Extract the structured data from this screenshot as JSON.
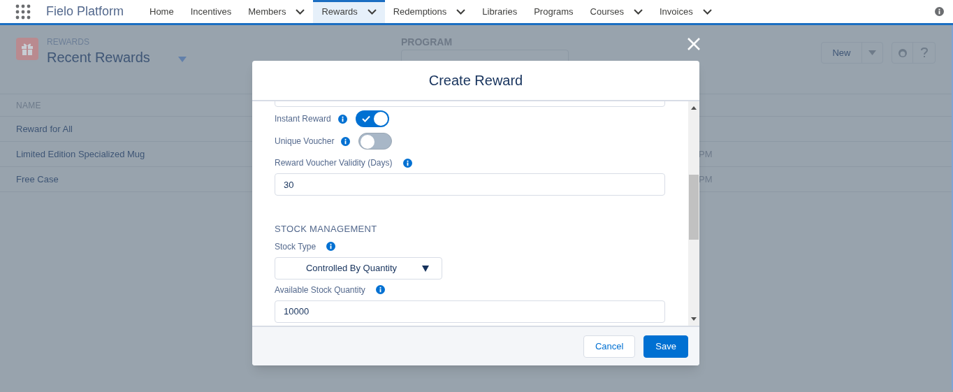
{
  "app": {
    "title": "Fielo Platform"
  },
  "nav": [
    {
      "label": "Home",
      "selected": false,
      "has_menu": false
    },
    {
      "label": "Incentives",
      "selected": false,
      "has_menu": false
    },
    {
      "label": "Members",
      "selected": false,
      "has_menu": true
    },
    {
      "label": "Rewards",
      "selected": true,
      "has_menu": true
    },
    {
      "label": "Redemptions",
      "selected": false,
      "has_menu": true
    },
    {
      "label": "Libraries",
      "selected": false,
      "has_menu": false
    },
    {
      "label": "Programs",
      "selected": false,
      "has_menu": false
    },
    {
      "label": "Courses",
      "selected": false,
      "has_menu": true
    },
    {
      "label": "Invoices",
      "selected": false,
      "has_menu": true
    }
  ],
  "page": {
    "object": "REWARDS",
    "list_view": "Recent Rewards",
    "program_label": "PROGRAM",
    "new_button": "New"
  },
  "table": {
    "columns": [
      "NAME"
    ],
    "rows": [
      {
        "name": "Reward for All",
        "column_2": ""
      },
      {
        "name": "Limited Edition Specialized Mug",
        "column_2": "PM"
      },
      {
        "name": "Free Case",
        "column_2": "PM"
      }
    ]
  },
  "modal": {
    "title": "Create Reward",
    "fields": [
      {
        "kind": "toggle",
        "label": "Instant Reward",
        "checked": true
      },
      {
        "kind": "toggle",
        "label": "Unique Voucher",
        "checked": false
      },
      {
        "kind": "input",
        "label": "Reward Voucher Validity (Days)",
        "value": "30"
      },
      {
        "kind": "section",
        "label": "STOCK MANAGEMENT"
      },
      {
        "kind": "select",
        "label": "Stock Type",
        "value": "Controlled By Quantity"
      },
      {
        "kind": "input",
        "label": "Available Stock Quantity",
        "value": "10000"
      }
    ],
    "buttons": [
      {
        "label": "Cancel",
        "kind": "neutral"
      },
      {
        "label": "Save",
        "kind": "brand"
      }
    ]
  }
}
